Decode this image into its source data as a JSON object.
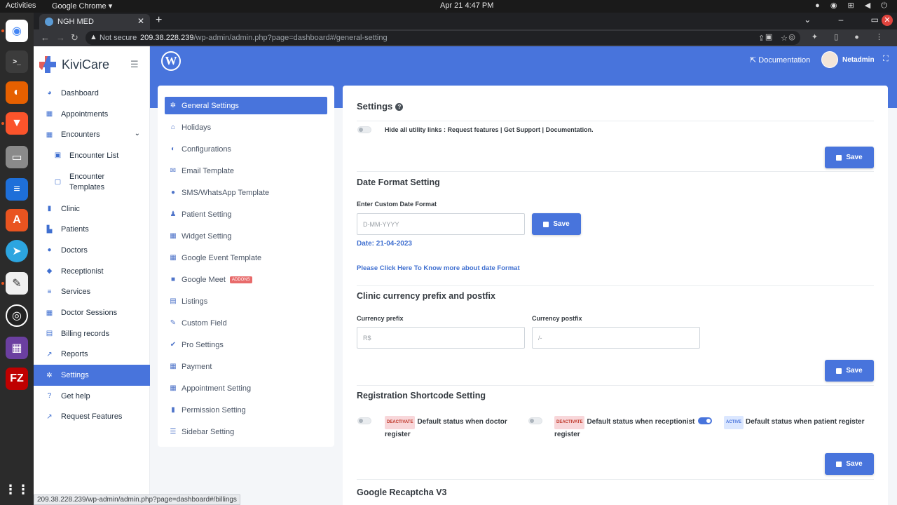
{
  "os_topbar": {
    "activities": "Activities",
    "app": "Google Chrome ▾",
    "clock": "Apr 21  4:47 PM"
  },
  "browser": {
    "tab_title": "NGH MED",
    "not_secure": "Not secure",
    "url_host": "209.38.228.239",
    "url_path": "/wp-admin/admin.php?page=dashboard#/general-setting",
    "status_url": "209.38.228.239/wp-admin/admin.php?page=dashboard#/billings"
  },
  "sidebar": {
    "logo_text": "KiviCare",
    "items": [
      {
        "label": "Dashboard",
        "icon": "dashboard-icon"
      },
      {
        "label": "Appointments",
        "icon": "calendar-icon"
      },
      {
        "label": "Encounters",
        "icon": "calendar-icon"
      },
      {
        "label": "Encounter List",
        "icon": "calendar-check-icon"
      },
      {
        "label": "Encounter Templates",
        "icon": "calendar-icon"
      },
      {
        "label": "Clinic",
        "icon": "hospital-icon"
      },
      {
        "label": "Patients",
        "icon": "patients-icon"
      },
      {
        "label": "Doctors",
        "icon": "doctor-icon"
      },
      {
        "label": "Receptionist",
        "icon": "users-icon"
      },
      {
        "label": "Services",
        "icon": "list-icon"
      },
      {
        "label": "Doctor Sessions",
        "icon": "calendar-icon"
      },
      {
        "label": "Billing records",
        "icon": "file-icon"
      },
      {
        "label": "Reports",
        "icon": "chart-line-icon"
      },
      {
        "label": "Settings",
        "icon": "gears-icon"
      },
      {
        "label": "Get help",
        "icon": "question-circle-icon"
      },
      {
        "label": "Request Features",
        "icon": "external-link-icon"
      }
    ]
  },
  "header": {
    "documentation": "Documentation",
    "username": "Netadmin"
  },
  "settings_menu": {
    "items": [
      {
        "label": "General Settings",
        "icon": "gears-icon"
      },
      {
        "label": "Holidays",
        "icon": "home-icon"
      },
      {
        "label": "Configurations",
        "icon": "toggle-icon"
      },
      {
        "label": "Email Template",
        "icon": "envelope-icon"
      },
      {
        "label": "SMS/WhatsApp Template",
        "icon": "comment-icon"
      },
      {
        "label": "Patient Setting",
        "icon": "user-icon"
      },
      {
        "label": "Widget Setting",
        "icon": "calendar-icon"
      },
      {
        "label": "Google Event Template",
        "icon": "calendar-icon"
      },
      {
        "label": "Google Meet",
        "icon": "video-icon",
        "badge": "ADDONS"
      },
      {
        "label": "Listings",
        "icon": "list-icon"
      },
      {
        "label": "Custom Field",
        "icon": "magic-icon"
      },
      {
        "label": "Pro Settings",
        "icon": "wrench-icon"
      },
      {
        "label": "Payment",
        "icon": "calendar-icon"
      },
      {
        "label": "Appointment Setting",
        "icon": "calendar-icon"
      },
      {
        "label": "Permission Setting",
        "icon": "lock-icon"
      },
      {
        "label": "Sidebar Setting",
        "icon": "bars-icon"
      }
    ]
  },
  "main": {
    "settings_title": "Settings",
    "hide_links_label": "Hide all utility links : Request features | Get Support | Documentation.",
    "save_label": "Save",
    "date_section_title": "Date Format Setting",
    "date_field_label": "Enter Custom Date Format",
    "date_placeholder": "D-MM-YYYY",
    "date_preview": "Date: 21-04-2023",
    "date_help_link": "Please Click Here To Know more about date Format",
    "currency_section_title": "Clinic currency prefix and postfix",
    "currency_prefix_label": "Currency prefix",
    "currency_prefix_placeholder": "R$",
    "currency_postfix_label": "Currency postfix",
    "currency_postfix_placeholder": "/-",
    "registration_section_title": "Registration Shortcode Setting",
    "reg_doctor_badge": "DEACTIVATE",
    "reg_doctor_label": "Default status when doctor register",
    "reg_recep_badge": "DEACTIVATE",
    "reg_recep_label": "Default status when receptionist register",
    "reg_patient_badge": "ACTIVE",
    "reg_patient_label": "Default status when patient register",
    "recaptcha_title": "Google Recaptcha V3"
  },
  "colors": {
    "primary": "#4874dc",
    "danger_badge": "#f8d7da",
    "page_bg": "#f4f6f9"
  }
}
